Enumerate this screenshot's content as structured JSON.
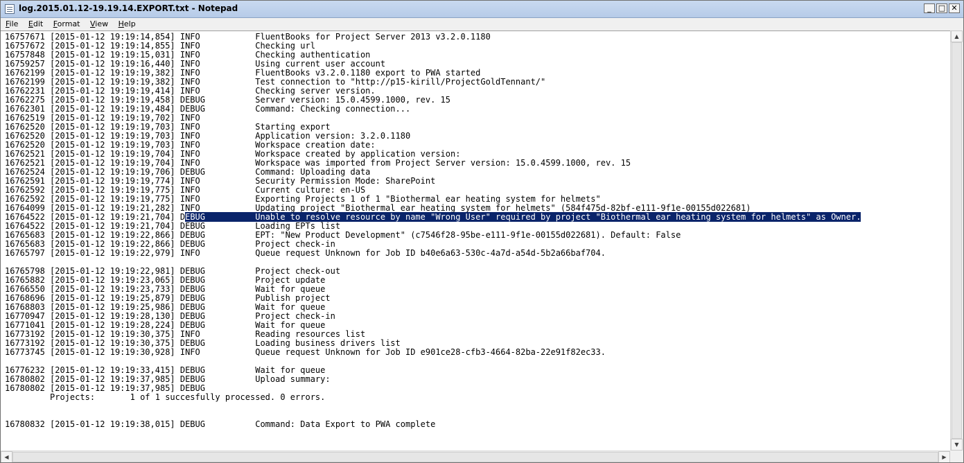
{
  "window": {
    "title": "log.2015.01.12-19.19.14.EXPORT.txt - Notepad",
    "minimize_glyph": "_",
    "maximize_glyph": "□",
    "close_glyph": "✕"
  },
  "menu": [
    "File",
    "Edit",
    "Format",
    "View",
    "Help"
  ],
  "log": {
    "before_highlight": "16757671 [2015-01-12 19:19:14,854] INFO           FluentBooks for Project Server 2013 v3.2.0.1180\n16757672 [2015-01-12 19:19:14,855] INFO           Checking url\n16757848 [2015-01-12 19:19:15,031] INFO           Checking authentication\n16759257 [2015-01-12 19:19:16,440] INFO           Using current user account\n16762199 [2015-01-12 19:19:19,382] INFO           FluentBooks v3.2.0.1180 export to PWA started\n16762199 [2015-01-12 19:19:19,382] INFO           Test connection to \"http://p15-kirill/ProjectGoldTennant/\"\n16762231 [2015-01-12 19:19:19,414] INFO           Checking server version.\n16762275 [2015-01-12 19:19:19,458] DEBUG          Server version: 15.0.4599.1000, rev. 15\n16762301 [2015-01-12 19:19:19,484] DEBUG          Command: Checking connection...\n16762519 [2015-01-12 19:19:19,702] INFO\n16762520 [2015-01-12 19:19:19,703] INFO           Starting export\n16762520 [2015-01-12 19:19:19,703] INFO           Application version: 3.2.0.1180\n16762520 [2015-01-12 19:19:19,703] INFO           Workspace creation date:\n16762521 [2015-01-12 19:19:19,704] INFO           Workspace created by application version:\n16762521 [2015-01-12 19:19:19,704] INFO           Workspace was imported from Project Server version: 15.0.4599.1000, rev. 15\n16762524 [2015-01-12 19:19:19,706] DEBUG          Command: Uploading data\n16762591 [2015-01-12 19:19:19,774] INFO           Security Permission Mode: SharePoint\n16762592 [2015-01-12 19:19:19,775] INFO           Current culture: en-US\n16762592 [2015-01-12 19:19:19,775] INFO           Exporting Projects 1 of 1 \"Biothermal ear heating system for helmets\"\n16764099 [2015-01-12 19:19:21,282] INFO           Updating project \"Biothermal ear heating system for helmets\" (584f475d-82bf-e111-9f1e-00155d022681)\n16764522 [2015-01-12 19:19:21,704] D",
    "highlighted": "EBUG          Unable to resolve resource by name \"Wrong User\" required by project \"Biothermal ear heating system for helmets\" as Owner.",
    "after_highlight": "\n16764522 [2015-01-12 19:19:21,704] DEBUG          Loading EPTs list\n16765683 [2015-01-12 19:19:22,866] DEBUG          EPT: \"New Product Development\" (c7546f28-95be-e111-9f1e-00155d022681). Default: False\n16765683 [2015-01-12 19:19:22,866] DEBUG          Project check-in\n16765797 [2015-01-12 19:19:22,979] INFO           Queue request Unknown for Job ID b40e6a63-530c-4a7d-a54d-5b2a66baf704.\n\n16765798 [2015-01-12 19:19:22,981] DEBUG          Project check-out\n16765882 [2015-01-12 19:19:23,065] DEBUG          Project update\n16766550 [2015-01-12 19:19:23,733] DEBUG          Wait for queue\n16768696 [2015-01-12 19:19:25,879] DEBUG          Publish project\n16768803 [2015-01-12 19:19:25,986] DEBUG          Wait for queue\n16770947 [2015-01-12 19:19:28,130] DEBUG          Project check-in\n16771041 [2015-01-12 19:19:28,224] DEBUG          Wait for queue\n16773192 [2015-01-12 19:19:30,375] INFO           Reading resources list\n16773192 [2015-01-12 19:19:30,375] DEBUG          Loading business drivers list\n16773745 [2015-01-12 19:19:30,928] INFO           Queue request Unknown for Job ID e901ce28-cfb3-4664-82ba-22e91f82ec33.\n\n16776232 [2015-01-12 19:19:33,415] DEBUG          Wait for queue\n16780802 [2015-01-12 19:19:37,985] DEBUG          Upload summary:\n16780802 [2015-01-12 19:19:37,985] DEBUG\n         Projects:       1 of 1 succesfully processed. 0 errors.\n\n\n16780832 [2015-01-12 19:19:38,015] DEBUG          Command: Data Export to PWA complete"
  },
  "colors": {
    "selection_bg": "#0a246a",
    "selection_fg": "#ffffff",
    "titlebar": "#b6cbe8"
  },
  "icons": {
    "app": "notepad-icon",
    "scroll_up": "arrow-up-icon",
    "scroll_down": "arrow-down-icon",
    "scroll_left": "arrow-left-icon",
    "scroll_right": "arrow-right-icon"
  }
}
